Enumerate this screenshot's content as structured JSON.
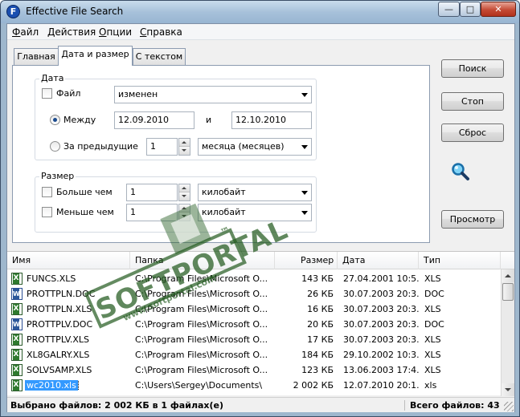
{
  "window": {
    "title": "Effective File Search",
    "controls": {
      "minimize": "—",
      "maximize": "□",
      "close": "✕"
    }
  },
  "menu": [
    {
      "label": "Файл",
      "u": "Ф",
      "rest": "айл"
    },
    {
      "label": "Действия",
      "u": "Д",
      "rest": "ействия"
    },
    {
      "label": "Опции",
      "u": "О",
      "rest": "пции"
    },
    {
      "label": "Справка",
      "u": "С",
      "rest": "правка"
    }
  ],
  "tabs": [
    "Главная",
    "Дата и размер",
    "С текстом"
  ],
  "date_group": {
    "title": "Дата",
    "file_label": "Файл",
    "file_combo": "изменен",
    "between_label": "Между",
    "date_from": "12.09.2010",
    "and_label": "и",
    "date_to": "12.10.2010",
    "previous_label": "За предыдущие",
    "previous_value": "1",
    "period_combo": "месяца (месяцев)"
  },
  "size_group": {
    "title": "Размер",
    "greater_label": "Больше чем",
    "greater_value": "1",
    "greater_unit": "килобайт",
    "less_label": "Меньше чем",
    "less_value": "1",
    "less_unit": "килобайт"
  },
  "buttons": {
    "search": "Поиск",
    "stop": "Стоп",
    "reset": "Сброс",
    "preview": "Просмотр"
  },
  "list": {
    "columns": [
      "Имя",
      "Папка",
      "Размер",
      "Дата",
      "Тип"
    ],
    "rows": [
      {
        "icon": "xls",
        "name": "FUNCS.XLS",
        "folder": "C:\\Program Files\\Microsoft O...",
        "size": "143 КБ",
        "date": "27.04.2001 10:5...",
        "type": "XLS"
      },
      {
        "icon": "doc",
        "name": "PROTTPLN.DOC",
        "folder": "C:\\Program Files\\Microsoft O...",
        "size": "26 КБ",
        "date": "30.07.2003 20:3...",
        "type": "DOC"
      },
      {
        "icon": "xls",
        "name": "PROTTPLN.XLS",
        "folder": "C:\\Program Files\\Microsoft O...",
        "size": "16 КБ",
        "date": "30.07.2003 20:3...",
        "type": "XLS"
      },
      {
        "icon": "doc",
        "name": "PROTTPLV.DOC",
        "folder": "C:\\Program Files\\Microsoft O...",
        "size": "20 КБ",
        "date": "30.07.2003 20:3...",
        "type": "DOC"
      },
      {
        "icon": "xls",
        "name": "PROTTPLV.XLS",
        "folder": "C:\\Program Files\\Microsoft O...",
        "size": "17 КБ",
        "date": "30.07.2003 20:3...",
        "type": "XLS"
      },
      {
        "icon": "xls",
        "name": "XL8GALRY.XLS",
        "folder": "C:\\Program Files\\Microsoft O...",
        "size": "184 КБ",
        "date": "29.10.2002 10:3...",
        "type": "XLS"
      },
      {
        "icon": "xls",
        "name": "SOLVSAMP.XLS",
        "folder": "C:\\Program Files\\Microsoft O...",
        "size": "123 КБ",
        "date": "13.06.2003 17:4...",
        "type": "XLS"
      },
      {
        "icon": "xls",
        "name": "wc2010.xls",
        "folder": "C:\\Users\\Sergey\\Documents\\",
        "size": "2 002 КБ",
        "date": "12.07.2010 20:1...",
        "type": "xls",
        "selected": true
      }
    ]
  },
  "status": {
    "selected": "Выбрано файлов: 2 002 КБ в 1 файлах(е)",
    "total": "Всего файлов: 43"
  },
  "watermark": {
    "brand": "SOFTPORTAL",
    "tm": "™",
    "url": "www.softportal.com"
  }
}
